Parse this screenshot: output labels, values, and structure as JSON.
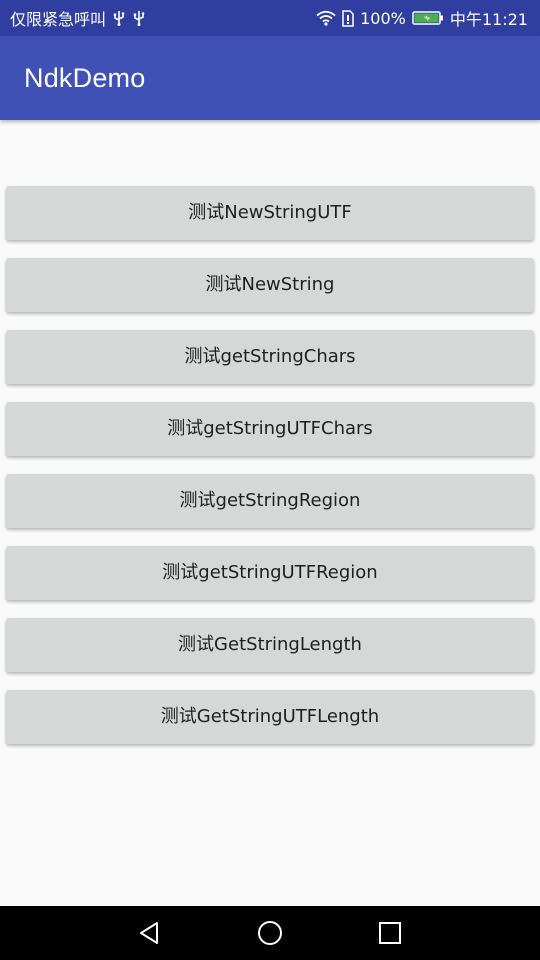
{
  "status_bar": {
    "carrier_text": "仅限紧急呼叫",
    "left_icons": [
      "usb-icon",
      "usb-icon"
    ],
    "right_icons": [
      "wifi-icon",
      "sim-icon",
      "battery-icon"
    ],
    "battery": "100%",
    "battery_level": 1.0,
    "time": "中午11:21",
    "colors": {
      "background": "#303F9F",
      "battery_fill": "#4CAF50"
    }
  },
  "app_bar": {
    "title": "NdkDemo",
    "color": "#3F51B5"
  },
  "buttons": [
    {
      "label": "测试NewStringUTF"
    },
    {
      "label": "测试NewString"
    },
    {
      "label": "测试getStringChars"
    },
    {
      "label": "测试getStringUTFChars"
    },
    {
      "label": "测试getStringRegion"
    },
    {
      "label": "测试getStringUTFRegion"
    },
    {
      "label": "测试GetStringLength"
    },
    {
      "label": "测试GetStringUTFLength"
    }
  ],
  "nav_bar": {
    "icons": [
      "back-icon",
      "home-icon",
      "recent-apps-icon"
    ]
  }
}
